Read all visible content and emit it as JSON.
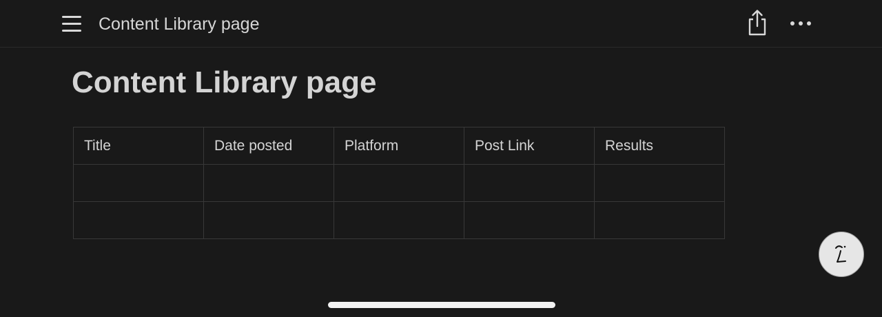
{
  "header": {
    "breadcrumb_title": "Content Library page",
    "menu_icon": "hamburger-menu-icon",
    "share_icon": "share-icon",
    "more_icon": "more-horizontal-icon"
  },
  "page": {
    "title": "Content Library page"
  },
  "table": {
    "columns": [
      "Title",
      "Date posted",
      "Platform",
      "Post Link",
      "Results"
    ],
    "rows": [
      [
        "",
        "",
        "",
        "",
        ""
      ],
      [
        "",
        "",
        "",
        "",
        ""
      ]
    ]
  },
  "fab": {
    "icon": "assistant-face-icon"
  },
  "colors": {
    "background": "#191919",
    "text": "#d4d4d4",
    "border": "#383838",
    "fab_background": "#e6e6e6"
  }
}
